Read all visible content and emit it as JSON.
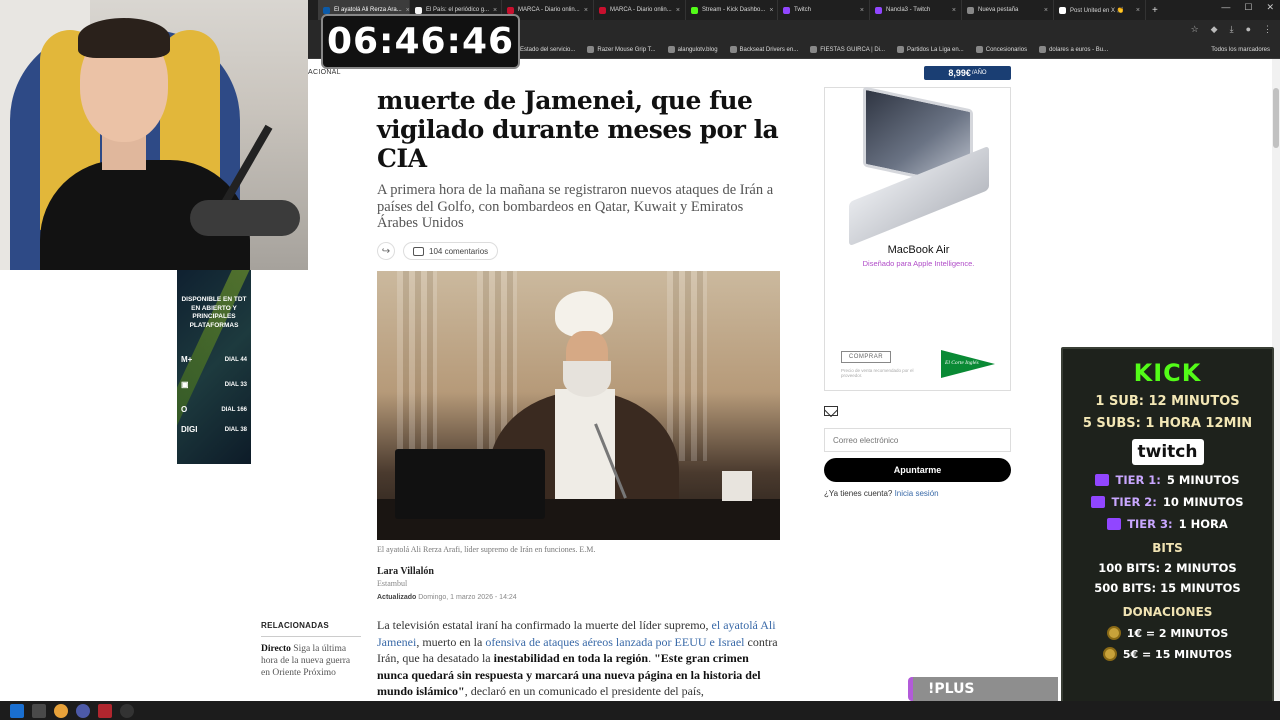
{
  "browser": {
    "tabs": [
      {
        "label": "El ayatolá Ali Rerza Ara...",
        "color": "#0b5aa8",
        "active": true
      },
      {
        "label": "El País: el periódico g...",
        "color": "#f5f5f5",
        "active": false
      },
      {
        "label": "MARCA - Diario onlin...",
        "color": "#c8102e",
        "active": false
      },
      {
        "label": "MARCA - Diario onlin...",
        "color": "#c8102e",
        "active": false
      },
      {
        "label": "Stream - Kick Dashbo...",
        "color": "#53fc18",
        "active": false
      },
      {
        "label": "Twitch",
        "color": "#9146ff",
        "active": false
      },
      {
        "label": "Nancla3 - Twitch",
        "color": "#9146ff",
        "active": false
      },
      {
        "label": "Nueva pestaña",
        "color": "#888888",
        "active": false
      },
      {
        "label": "Post United en X 👏",
        "color": "#ffffff",
        "active": false
      }
    ],
    "bookmarks": [
      "Estado del servicio...",
      "Razer Mouse Grip T...",
      "alangulotv.blog",
      "Backseat Drivers en...",
      "FIESTAS GUIRCA | Di...",
      "Partidos La Liga en...",
      "Concesionarios",
      "dolares a euros - Bu..."
    ],
    "bookmarks_all": "Todos los marcadores"
  },
  "article": {
    "section": "ACIONAL",
    "subscribe_price": "8,99€",
    "subscribe_unit": "/AÑO",
    "headline": "muerte de Jamenei, que fue vigilado durante meses por la CIA",
    "standfirst": "A primera hora de la mañana se registraron nuevos ataques de Irán a países del Golfo, con bombardeos en Qatar, Kuwait y Emiratos Árabes Unidos",
    "comments": "104 comentarios",
    "caption": "El ayatolá Ali Rerza Arafi, líder supremo de Irán en funciones.",
    "caption_credit": "E.M.",
    "author": "Lara Villalón",
    "location": "Estambul",
    "updated_label": "Actualizado",
    "updated_date": "Domingo, 1 marzo 2026 - 14:24",
    "body": {
      "p1": "La televisión estatal iraní ha confirmado la muerte del líder supremo,",
      "link1": "el ayatolá Ali Jamenei",
      "p2": ", muerto en la",
      "link2": "ofensiva de ataques aéreos lanzada por EEUU e Israel",
      "p3": " contra Irán, que ha desatado la",
      "bold1": "inestabilidad en toda la región",
      "p4": ". ",
      "bold2": "\"Este gran crimen nunca quedará sin respuesta y marcará una nueva página en la historia del mundo islámico\"",
      "p5": ", declaró en un comunicado el presidente del país,"
    }
  },
  "related": {
    "title": "RELACIONADAS",
    "item_bold": "Directo",
    "item_text": " Siga la última hora de la nueva guerra en Oriente Próximo"
  },
  "ad_mac": {
    "title": "MacBook Air",
    "subtitle": "Diseñado para Apple Intelligence.",
    "buy": "COMPRAR",
    "small": "Precio de venta recomendado por el proveedor.",
    "store": "El Corte Inglés"
  },
  "newsletter": {
    "email_placeholder": "Correo electrónico",
    "button": "Apuntarme",
    "login_q": "¿Ya tienes cuenta?",
    "login_link": "Inicia sesión"
  },
  "tv_ad": {
    "heading": "DISPONIBLE EN TDT EN ABIERTO Y PRINCIPALES PLATAFORMAS",
    "channels": [
      {
        "logo": "M+",
        "dial": "DIAL 44"
      },
      {
        "logo": "▣",
        "dial": "DIAL 33"
      },
      {
        "logo": "O",
        "dial": "DIAL 166"
      },
      {
        "logo": "DIGI",
        "dial": "DIAL 38"
      }
    ]
  },
  "timer": "06:46:46",
  "kick_panel": {
    "kick": "KICK",
    "sub1": "1 SUB: 12 MINUTOS",
    "sub5": "5 SUBS: 1 HORA 12MIN",
    "twitch": "twitch",
    "tiers": [
      {
        "name": "TIER 1:",
        "value": "5 MINUTOS"
      },
      {
        "name": "TIER 2:",
        "value": "10 MINUTOS"
      },
      {
        "name": "TIER 3:",
        "value": "1 HORA"
      }
    ],
    "bits_title": "BITS",
    "bits": [
      "100 BITS: 2 MINUTOS",
      "500 BITS: 15 MINUTOS"
    ],
    "donations_title": "DONACIONES",
    "donations": [
      "1€ = 2 MINUTOS",
      "5€ = 15 MINUTOS"
    ]
  },
  "plus": "!PLUS"
}
